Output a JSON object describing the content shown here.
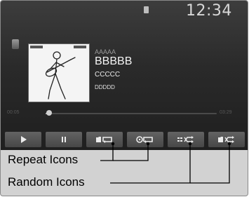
{
  "clock": "12:34",
  "track": {
    "album": "AAAAA",
    "title": "BBBBB",
    "artist": "CCCCC",
    "extra": "DDDDD"
  },
  "progress": {
    "elapsed": "00:05",
    "remaining": "03:29",
    "fraction": 0.02
  },
  "controls": [
    {
      "name": "play-button",
      "icon": "play-icon"
    },
    {
      "name": "pause-button",
      "icon": "pause-icon"
    },
    {
      "name": "repeat-folder-button",
      "icon": "repeat-folder-icon"
    },
    {
      "name": "repeat-track-button",
      "icon": "repeat-track-icon"
    },
    {
      "name": "random-button",
      "icon": "shuffle-icon"
    },
    {
      "name": "random-folder-button",
      "icon": "shuffle-folder-icon"
    }
  ],
  "callouts": {
    "repeat_label": "Repeat Icons",
    "random_label": "Random Icons"
  },
  "colors": {
    "screen": "#2a2a2a",
    "button": "#555555",
    "icon": "#ececec"
  }
}
